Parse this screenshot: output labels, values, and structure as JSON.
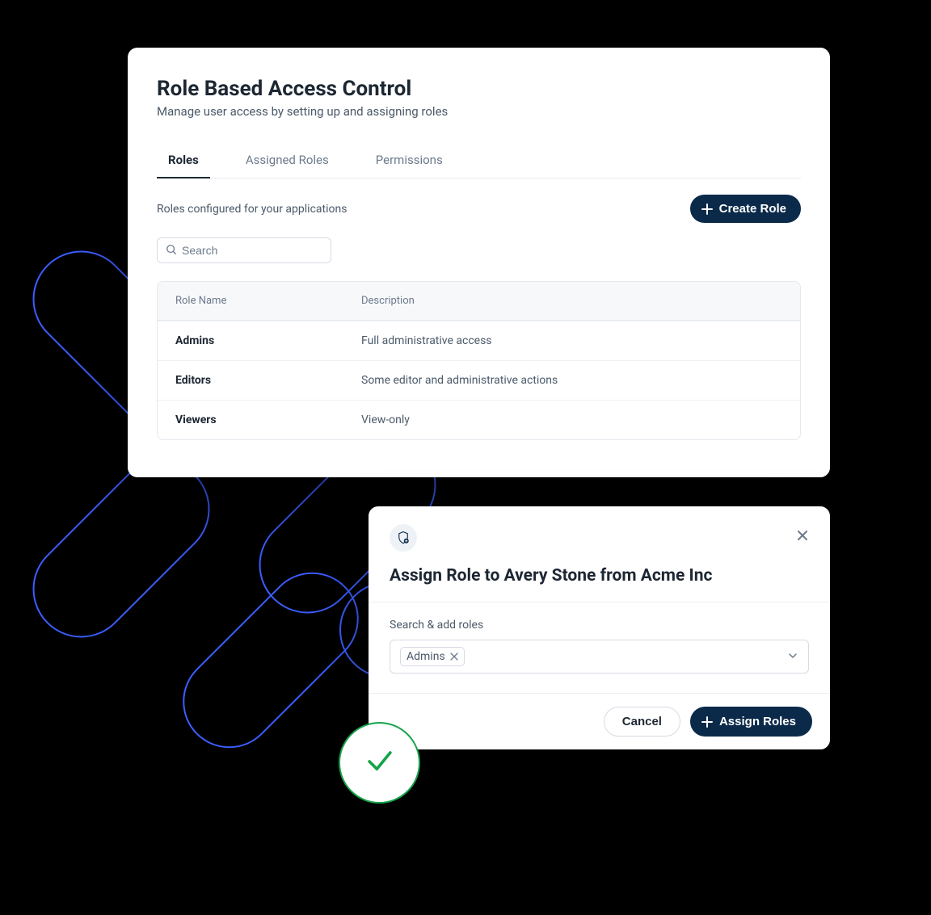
{
  "main": {
    "title": "Role Based Access Control",
    "subtitle": "Manage user access by setting up and assigning roles",
    "tabs": [
      {
        "label": "Roles"
      },
      {
        "label": "Assigned Roles"
      },
      {
        "label": "Permissions"
      }
    ],
    "roles_section_desc": "Roles configured for your applications",
    "create_role_label": "Create Role",
    "search_placeholder": "Search",
    "table": {
      "headers": {
        "name": "Role Name",
        "desc": "Description"
      },
      "rows": [
        {
          "name": "Admins",
          "desc": "Full administrative access"
        },
        {
          "name": "Editors",
          "desc": "Some editor and administrative actions"
        },
        {
          "name": "Viewers",
          "desc": "View-only"
        }
      ]
    }
  },
  "modal": {
    "title": "Assign Role to Avery Stone from Acme Inc",
    "field_label": "Search & add roles",
    "selected_chip": "Admins",
    "cancel_label": "Cancel",
    "assign_label": "Assign Roles"
  }
}
